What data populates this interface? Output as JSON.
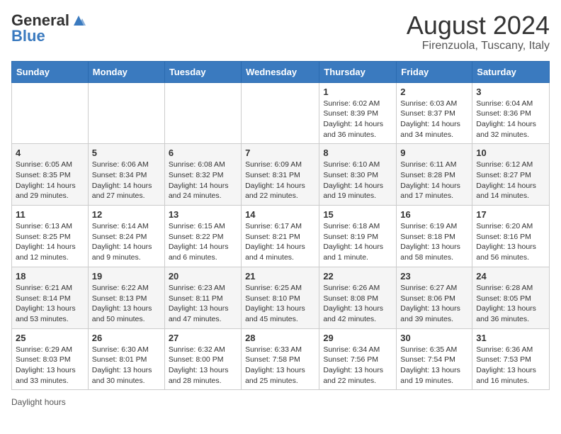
{
  "header": {
    "logo_general": "General",
    "logo_blue": "Blue",
    "month_title": "August 2024",
    "location": "Firenzuola, Tuscany, Italy"
  },
  "calendar": {
    "days_of_week": [
      "Sunday",
      "Monday",
      "Tuesday",
      "Wednesday",
      "Thursday",
      "Friday",
      "Saturday"
    ],
    "weeks": [
      [
        {
          "day": "",
          "info": ""
        },
        {
          "day": "",
          "info": ""
        },
        {
          "day": "",
          "info": ""
        },
        {
          "day": "",
          "info": ""
        },
        {
          "day": "1",
          "info": "Sunrise: 6:02 AM\nSunset: 8:39 PM\nDaylight: 14 hours and 36 minutes."
        },
        {
          "day": "2",
          "info": "Sunrise: 6:03 AM\nSunset: 8:37 PM\nDaylight: 14 hours and 34 minutes."
        },
        {
          "day": "3",
          "info": "Sunrise: 6:04 AM\nSunset: 8:36 PM\nDaylight: 14 hours and 32 minutes."
        }
      ],
      [
        {
          "day": "4",
          "info": "Sunrise: 6:05 AM\nSunset: 8:35 PM\nDaylight: 14 hours and 29 minutes."
        },
        {
          "day": "5",
          "info": "Sunrise: 6:06 AM\nSunset: 8:34 PM\nDaylight: 14 hours and 27 minutes."
        },
        {
          "day": "6",
          "info": "Sunrise: 6:08 AM\nSunset: 8:32 PM\nDaylight: 14 hours and 24 minutes."
        },
        {
          "day": "7",
          "info": "Sunrise: 6:09 AM\nSunset: 8:31 PM\nDaylight: 14 hours and 22 minutes."
        },
        {
          "day": "8",
          "info": "Sunrise: 6:10 AM\nSunset: 8:30 PM\nDaylight: 14 hours and 19 minutes."
        },
        {
          "day": "9",
          "info": "Sunrise: 6:11 AM\nSunset: 8:28 PM\nDaylight: 14 hours and 17 minutes."
        },
        {
          "day": "10",
          "info": "Sunrise: 6:12 AM\nSunset: 8:27 PM\nDaylight: 14 hours and 14 minutes."
        }
      ],
      [
        {
          "day": "11",
          "info": "Sunrise: 6:13 AM\nSunset: 8:25 PM\nDaylight: 14 hours and 12 minutes."
        },
        {
          "day": "12",
          "info": "Sunrise: 6:14 AM\nSunset: 8:24 PM\nDaylight: 14 hours and 9 minutes."
        },
        {
          "day": "13",
          "info": "Sunrise: 6:15 AM\nSunset: 8:22 PM\nDaylight: 14 hours and 6 minutes."
        },
        {
          "day": "14",
          "info": "Sunrise: 6:17 AM\nSunset: 8:21 PM\nDaylight: 14 hours and 4 minutes."
        },
        {
          "day": "15",
          "info": "Sunrise: 6:18 AM\nSunset: 8:19 PM\nDaylight: 14 hours and 1 minute."
        },
        {
          "day": "16",
          "info": "Sunrise: 6:19 AM\nSunset: 8:18 PM\nDaylight: 13 hours and 58 minutes."
        },
        {
          "day": "17",
          "info": "Sunrise: 6:20 AM\nSunset: 8:16 PM\nDaylight: 13 hours and 56 minutes."
        }
      ],
      [
        {
          "day": "18",
          "info": "Sunrise: 6:21 AM\nSunset: 8:14 PM\nDaylight: 13 hours and 53 minutes."
        },
        {
          "day": "19",
          "info": "Sunrise: 6:22 AM\nSunset: 8:13 PM\nDaylight: 13 hours and 50 minutes."
        },
        {
          "day": "20",
          "info": "Sunrise: 6:23 AM\nSunset: 8:11 PM\nDaylight: 13 hours and 47 minutes."
        },
        {
          "day": "21",
          "info": "Sunrise: 6:25 AM\nSunset: 8:10 PM\nDaylight: 13 hours and 45 minutes."
        },
        {
          "day": "22",
          "info": "Sunrise: 6:26 AM\nSunset: 8:08 PM\nDaylight: 13 hours and 42 minutes."
        },
        {
          "day": "23",
          "info": "Sunrise: 6:27 AM\nSunset: 8:06 PM\nDaylight: 13 hours and 39 minutes."
        },
        {
          "day": "24",
          "info": "Sunrise: 6:28 AM\nSunset: 8:05 PM\nDaylight: 13 hours and 36 minutes."
        }
      ],
      [
        {
          "day": "25",
          "info": "Sunrise: 6:29 AM\nSunset: 8:03 PM\nDaylight: 13 hours and 33 minutes."
        },
        {
          "day": "26",
          "info": "Sunrise: 6:30 AM\nSunset: 8:01 PM\nDaylight: 13 hours and 30 minutes."
        },
        {
          "day": "27",
          "info": "Sunrise: 6:32 AM\nSunset: 8:00 PM\nDaylight: 13 hours and 28 minutes."
        },
        {
          "day": "28",
          "info": "Sunrise: 6:33 AM\nSunset: 7:58 PM\nDaylight: 13 hours and 25 minutes."
        },
        {
          "day": "29",
          "info": "Sunrise: 6:34 AM\nSunset: 7:56 PM\nDaylight: 13 hours and 22 minutes."
        },
        {
          "day": "30",
          "info": "Sunrise: 6:35 AM\nSunset: 7:54 PM\nDaylight: 13 hours and 19 minutes."
        },
        {
          "day": "31",
          "info": "Sunrise: 6:36 AM\nSunset: 7:53 PM\nDaylight: 13 hours and 16 minutes."
        }
      ]
    ]
  },
  "footer": {
    "note": "Daylight hours"
  }
}
